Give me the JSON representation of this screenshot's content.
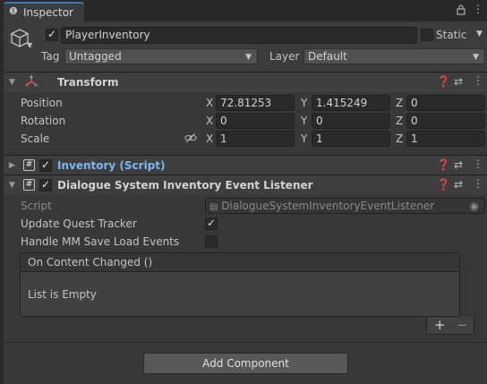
{
  "tab": {
    "icon": "info-icon",
    "title": "Inspector"
  },
  "tab_icons": [
    "lock-icon",
    "menu-icon"
  ],
  "object": {
    "name": "PlayerInventory",
    "active": true,
    "static_label": "Static",
    "static": false,
    "tag_label": "Tag",
    "tag_value": "Untagged",
    "layer_label": "Layer",
    "layer_value": "Default"
  },
  "transform": {
    "title": "Transform",
    "rows": [
      {
        "label": "Position",
        "x": "72.81253",
        "y": "1.415249",
        "z": "0"
      },
      {
        "label": "Rotation",
        "x": "0",
        "y": "0",
        "z": "0"
      },
      {
        "label": "Scale",
        "x": "1",
        "y": "1",
        "z": "1"
      }
    ],
    "axis": {
      "x": "X",
      "y": "Y",
      "z": "Z"
    }
  },
  "inventory": {
    "title": "Inventory (Script)",
    "enabled": true,
    "link_color": "#7ab8f5"
  },
  "listener": {
    "title": "Dialogue System Inventory Event Listener",
    "enabled": true,
    "script_label": "Script",
    "script_value": "DialogueSystemInventoryEventListener",
    "update_label": "Update Quest Tracker",
    "update_value": true,
    "handle_label": "Handle MM Save Load Events",
    "handle_value": false,
    "event_title": "On Content Changed ()",
    "event_empty": "List is Empty",
    "plus": "+",
    "minus": "−"
  },
  "add_component": "Add Component"
}
